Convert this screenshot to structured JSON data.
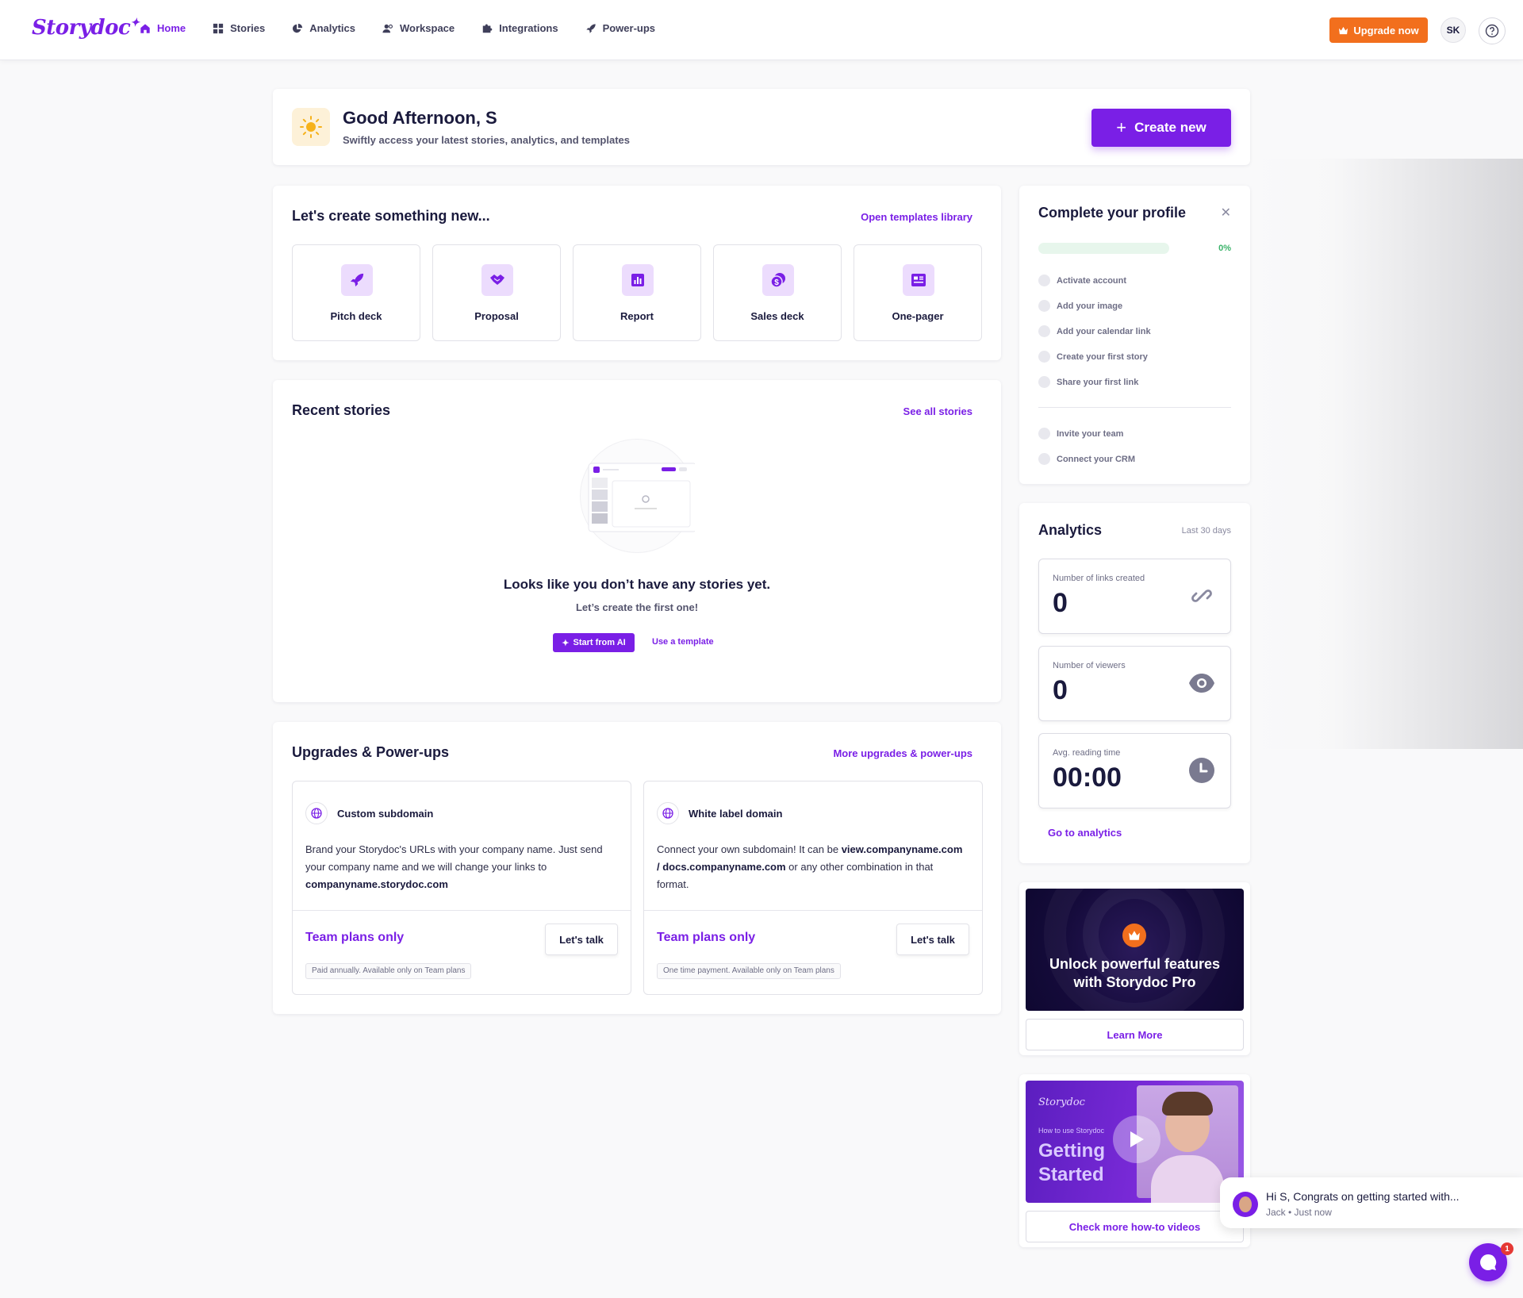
{
  "brand": {
    "name": "Storydoc",
    "accent": "#7a1fe6",
    "upgrade_color": "#f26f1d"
  },
  "nav": {
    "items": [
      {
        "label": "Home",
        "icon": "home-icon",
        "active": true
      },
      {
        "label": "Stories",
        "icon": "grid-icon"
      },
      {
        "label": "Analytics",
        "icon": "pie-chart-icon"
      },
      {
        "label": "Workspace",
        "icon": "users-icon"
      },
      {
        "label": "Integrations",
        "icon": "puzzle-icon"
      },
      {
        "label": "Power-ups",
        "icon": "rocket-icon"
      }
    ],
    "upgrade_label": "Upgrade now",
    "avatar_initials": "SK"
  },
  "greeting": {
    "title": "Good Afternoon, S",
    "subtitle": "Swiftly access your latest stories, analytics, and templates",
    "create_label": "Create new"
  },
  "create": {
    "title": "Let's create something new...",
    "link": "Open templates library",
    "templates": [
      {
        "label": "Pitch deck",
        "icon": "rocket-icon"
      },
      {
        "label": "Proposal",
        "icon": "handshake-icon"
      },
      {
        "label": "Report",
        "icon": "bar-chart-icon"
      },
      {
        "label": "Sales deck",
        "icon": "coins-icon"
      },
      {
        "label": "One-pager",
        "icon": "document-icon"
      }
    ]
  },
  "recent": {
    "title": "Recent stories",
    "link": "See all stories",
    "empty_title": "Looks like you don’t have any stories yet.",
    "empty_sub": "Let’s create the first one!",
    "ai_label": "Start from AI",
    "template_label": "Use a template"
  },
  "upgrades": {
    "title": "Upgrades & Power-ups",
    "link": "More upgrades & power-ups",
    "items": [
      {
        "title": "Custom subdomain",
        "desc_1": "Brand your Storydoc's URLs with your company name. Just send your company name and we will change your links to ",
        "desc_bold_1": "companyname.storydoc.com",
        "plan": "Team plans only",
        "cta": "Let's talk",
        "note": "Paid annually. Available only on Team plans"
      },
      {
        "title": "White label domain",
        "desc_1": "Connect your own subdomain! It can be ",
        "desc_bold_1": "view.companyname.com / docs.companyname.com",
        "desc_2": " or any other combination in that format.",
        "plan": "Team plans only",
        "cta": "Let's talk",
        "note": "One time payment. Available only on Team plans"
      }
    ]
  },
  "profile": {
    "title": "Complete your profile",
    "progress": "0%",
    "progress_value": 0,
    "tasks": [
      "Activate account",
      "Add your image",
      "Add your calendar link",
      "Create your first story",
      "Share your first link"
    ],
    "extra_tasks": [
      "Invite your team",
      "Connect your CRM"
    ]
  },
  "analytics": {
    "title": "Analytics",
    "range": "Last 30 days",
    "metrics": [
      {
        "label": "Number of links created",
        "value": "0",
        "icon": "link-icon"
      },
      {
        "label": "Number of viewers",
        "value": "0",
        "icon": "eye-icon"
      },
      {
        "label": "Avg. reading time",
        "value": "00:00",
        "icon": "clock-icon"
      }
    ],
    "link": "Go to analytics"
  },
  "pro": {
    "line1": "Unlock powerful features",
    "line2": "with Storydoc Pro",
    "cta": "Learn More"
  },
  "video": {
    "logo": "Storydoc",
    "small": "How to use Storydoc",
    "big1": "Getting",
    "big2": "Started",
    "cta": "Check more how-to videos"
  },
  "chat": {
    "message": "Hi S, Congrats on getting started with...",
    "meta": "Jack • Just now",
    "badge": "1"
  }
}
